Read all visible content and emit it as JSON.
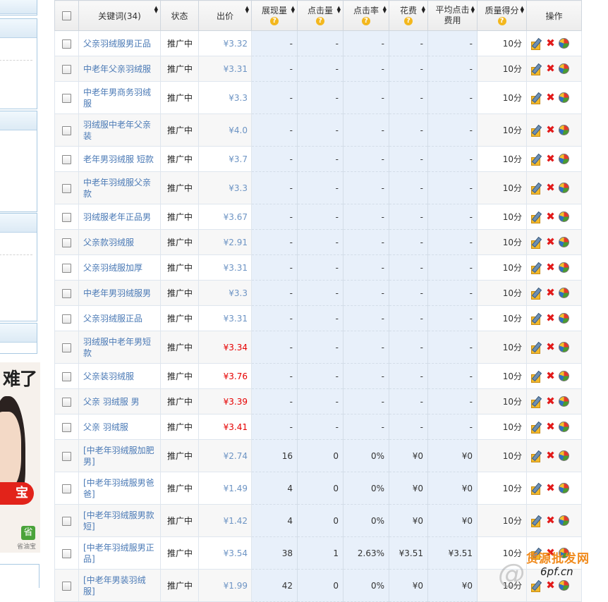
{
  "headers": {
    "keyword": "关键词(34)",
    "status": "状态",
    "bid": "出价",
    "impressions": "展现量",
    "clicks": "点击量",
    "ctr": "点击率",
    "cost": "花费",
    "avg_cpc": "平均点击费用",
    "quality": "质量得分",
    "actions": "操作"
  },
  "help_icon": "?",
  "colors": {
    "bid_normal": "#6d94c4",
    "bid_high": "#e60000",
    "metric_bg": "#e8f0fa",
    "keyword_link": "#4a79b5"
  },
  "rows": [
    {
      "keyword": "父亲羽绒服男正品",
      "status": "推广中",
      "bid": "¥3.32",
      "bid_red": false,
      "impr": "-",
      "clicks": "-",
      "ctr": "-",
      "cost": "-",
      "cpc": "-",
      "quality": "10分"
    },
    {
      "keyword": "中老年父亲羽绒服",
      "status": "推广中",
      "bid": "¥3.31",
      "bid_red": false,
      "impr": "-",
      "clicks": "-",
      "ctr": "-",
      "cost": "-",
      "cpc": "-",
      "quality": "10分"
    },
    {
      "keyword": "中老年男商务羽绒服",
      "status": "推广中",
      "bid": "¥3.3",
      "bid_red": false,
      "impr": "-",
      "clicks": "-",
      "ctr": "-",
      "cost": "-",
      "cpc": "-",
      "quality": "10分"
    },
    {
      "keyword": "羽绒服中老年父亲装",
      "status": "推广中",
      "bid": "¥4.0",
      "bid_red": false,
      "impr": "-",
      "clicks": "-",
      "ctr": "-",
      "cost": "-",
      "cpc": "-",
      "quality": "10分"
    },
    {
      "keyword": "老年男羽绒服 短款",
      "status": "推广中",
      "bid": "¥3.7",
      "bid_red": false,
      "impr": "-",
      "clicks": "-",
      "ctr": "-",
      "cost": "-",
      "cpc": "-",
      "quality": "10分"
    },
    {
      "keyword": "中老年羽绒服父亲款",
      "status": "推广中",
      "bid": "¥3.3",
      "bid_red": false,
      "impr": "-",
      "clicks": "-",
      "ctr": "-",
      "cost": "-",
      "cpc": "-",
      "quality": "10分"
    },
    {
      "keyword": "羽绒服老年正品男",
      "status": "推广中",
      "bid": "¥3.67",
      "bid_red": false,
      "impr": "-",
      "clicks": "-",
      "ctr": "-",
      "cost": "-",
      "cpc": "-",
      "quality": "10分"
    },
    {
      "keyword": "父亲款羽绒服",
      "status": "推广中",
      "bid": "¥2.91",
      "bid_red": false,
      "impr": "-",
      "clicks": "-",
      "ctr": "-",
      "cost": "-",
      "cpc": "-",
      "quality": "10分"
    },
    {
      "keyword": "父亲羽绒服加厚",
      "status": "推广中",
      "bid": "¥3.31",
      "bid_red": false,
      "impr": "-",
      "clicks": "-",
      "ctr": "-",
      "cost": "-",
      "cpc": "-",
      "quality": "10分"
    },
    {
      "keyword": "中老年男羽绒服男",
      "status": "推广中",
      "bid": "¥3.3",
      "bid_red": false,
      "impr": "-",
      "clicks": "-",
      "ctr": "-",
      "cost": "-",
      "cpc": "-",
      "quality": "10分"
    },
    {
      "keyword": "父亲羽绒服正品",
      "status": "推广中",
      "bid": "¥3.31",
      "bid_red": false,
      "impr": "-",
      "clicks": "-",
      "ctr": "-",
      "cost": "-",
      "cpc": "-",
      "quality": "10分"
    },
    {
      "keyword": "羽绒服中老年男短款",
      "status": "推广中",
      "bid": "¥3.34",
      "bid_red": true,
      "impr": "-",
      "clicks": "-",
      "ctr": "-",
      "cost": "-",
      "cpc": "-",
      "quality": "10分"
    },
    {
      "keyword": "父亲装羽绒服",
      "status": "推广中",
      "bid": "¥3.76",
      "bid_red": true,
      "impr": "-",
      "clicks": "-",
      "ctr": "-",
      "cost": "-",
      "cpc": "-",
      "quality": "10分"
    },
    {
      "keyword": "父亲 羽绒服 男",
      "status": "推广中",
      "bid": "¥3.39",
      "bid_red": true,
      "impr": "-",
      "clicks": "-",
      "ctr": "-",
      "cost": "-",
      "cpc": "-",
      "quality": "10分"
    },
    {
      "keyword": "父亲 羽绒服",
      "status": "推广中",
      "bid": "¥3.41",
      "bid_red": true,
      "impr": "-",
      "clicks": "-",
      "ctr": "-",
      "cost": "-",
      "cpc": "-",
      "quality": "10分"
    },
    {
      "keyword": "[中老年羽绒服加肥男]",
      "status": "推广中",
      "bid": "¥2.74",
      "bid_red": false,
      "impr": "16",
      "clicks": "0",
      "ctr": "0%",
      "cost": "¥0",
      "cpc": "¥0",
      "quality": "10分"
    },
    {
      "keyword": "[中老年羽绒服男爸爸]",
      "status": "推广中",
      "bid": "¥1.49",
      "bid_red": false,
      "impr": "4",
      "clicks": "0",
      "ctr": "0%",
      "cost": "¥0",
      "cpc": "¥0",
      "quality": "10分"
    },
    {
      "keyword": "[中老年羽绒服男款短]",
      "status": "推广中",
      "bid": "¥1.42",
      "bid_red": false,
      "impr": "4",
      "clicks": "0",
      "ctr": "0%",
      "cost": "¥0",
      "cpc": "¥0",
      "quality": "10分"
    },
    {
      "keyword": "[中老年羽绒服男正品]",
      "status": "推广中",
      "bid": "¥3.54",
      "bid_red": false,
      "impr": "38",
      "clicks": "1",
      "ctr": "2.63%",
      "cost": "¥3.51",
      "cpc": "¥3.51",
      "quality": "10分"
    },
    {
      "keyword": "[中老年男装羽绒服]",
      "status": "推广中",
      "bid": "¥1.99",
      "bid_red": false,
      "impr": "42",
      "clicks": "0",
      "ctr": "0%",
      "cost": "¥0",
      "cpc": "¥0",
      "quality": "10分"
    }
  ],
  "ad": {
    "headline": "难了",
    "button": "宝",
    "logo_glyph": "省",
    "logo_text": "省油宝"
  },
  "watermark": {
    "line1": "货源批发网",
    "line2": "6pf.cn",
    "mark": "@"
  }
}
